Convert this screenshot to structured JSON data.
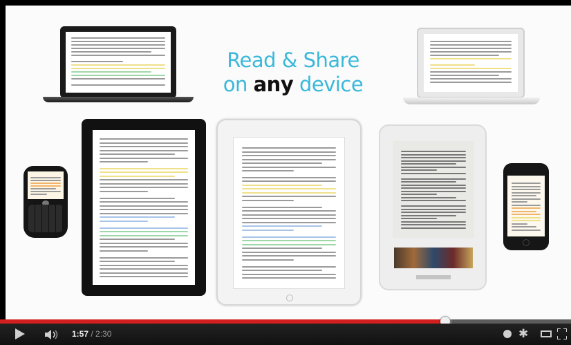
{
  "headline": {
    "line1": "Read & Share",
    "on": "on",
    "any": "any",
    "device": "device"
  },
  "player": {
    "current_time": "1:57",
    "separator": " / ",
    "duration": "2:30",
    "progress_fraction": 0.78,
    "buffered_fraction": 0.79
  },
  "icons": {
    "play": "play-icon",
    "volume": "volume-icon",
    "captions": "captions-icon",
    "settings": "gear-icon",
    "size": "theater-size-icon",
    "fullscreen": "fullscreen-icon"
  },
  "colors": {
    "headline_blue": "#3ab8da",
    "progress_red": "#d21f1f"
  }
}
